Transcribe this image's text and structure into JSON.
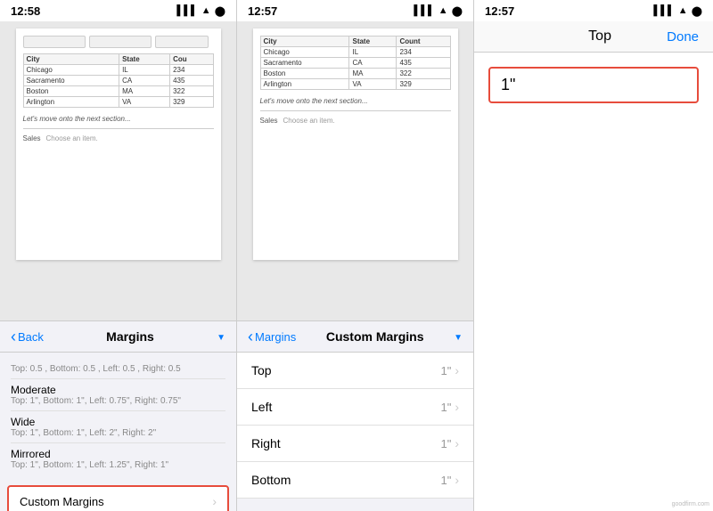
{
  "panel1": {
    "status": {
      "time": "12:58",
      "icons": "▌▌▌ ▲ ⬤"
    },
    "table": {
      "headers": [
        "City",
        "State",
        "Cou"
      ],
      "rows": [
        [
          "Chicago",
          "IL",
          "234"
        ],
        [
          "Sacramento",
          "CA",
          "435"
        ],
        [
          "Boston",
          "MA",
          "322"
        ],
        [
          "Arlington",
          "VA",
          "329"
        ]
      ]
    },
    "doc_text": "Let's move onto the next section...",
    "dropdown_label": "Sales",
    "dropdown_placeholder": "Choose an item.",
    "nav": {
      "back_label": "Back",
      "title": "Margins",
      "has_dropdown": true
    },
    "margins": [
      {
        "title": "Top: 0.5 , Bottom: 0.5 , Left: 0.5 , Right: 0.5",
        "desc": ""
      },
      {
        "title": "Moderate",
        "desc": "Top: 1\", Bottom: 1\", Left: 0.75\", Right: 0.75\""
      },
      {
        "title": "Wide",
        "desc": "Top: 1\", Bottom: 1\", Left: 2\", Right: 2\""
      },
      {
        "title": "Mirrored",
        "desc": "Top: 1\", Bottom: 1\", Left: 1.25\", Right: 1\""
      }
    ],
    "custom_margins_label": "Custom Margins"
  },
  "panel2": {
    "status": {
      "time": "12:57",
      "icons": "▌▌▌ ▲ ⬤"
    },
    "table": {
      "headers": [
        "City",
        "State",
        "Count"
      ],
      "rows": [
        [
          "Chicago",
          "IL",
          "234"
        ],
        [
          "Sacramento",
          "CA",
          "435"
        ],
        [
          "Boston",
          "MA",
          "322"
        ],
        [
          "Arlington",
          "VA",
          "329"
        ]
      ]
    },
    "doc_text": "Let's move onto the next section...",
    "dropdown_label": "Sales",
    "dropdown_placeholder": "Choose an item.",
    "nav": {
      "back_label": "Margins",
      "title": "Custom Margins",
      "has_dropdown": true
    },
    "items": [
      {
        "label": "Top",
        "value": "1\""
      },
      {
        "label": "Left",
        "value": "1\""
      },
      {
        "label": "Right",
        "value": "1\""
      },
      {
        "label": "Bottom",
        "value": "1\""
      }
    ]
  },
  "panel3": {
    "status": {
      "time": "12:57",
      "icons": "▌▌▌ ▲ ⬤"
    },
    "header": {
      "title": "Top",
      "done_label": "Done"
    },
    "input_value": "1\""
  }
}
